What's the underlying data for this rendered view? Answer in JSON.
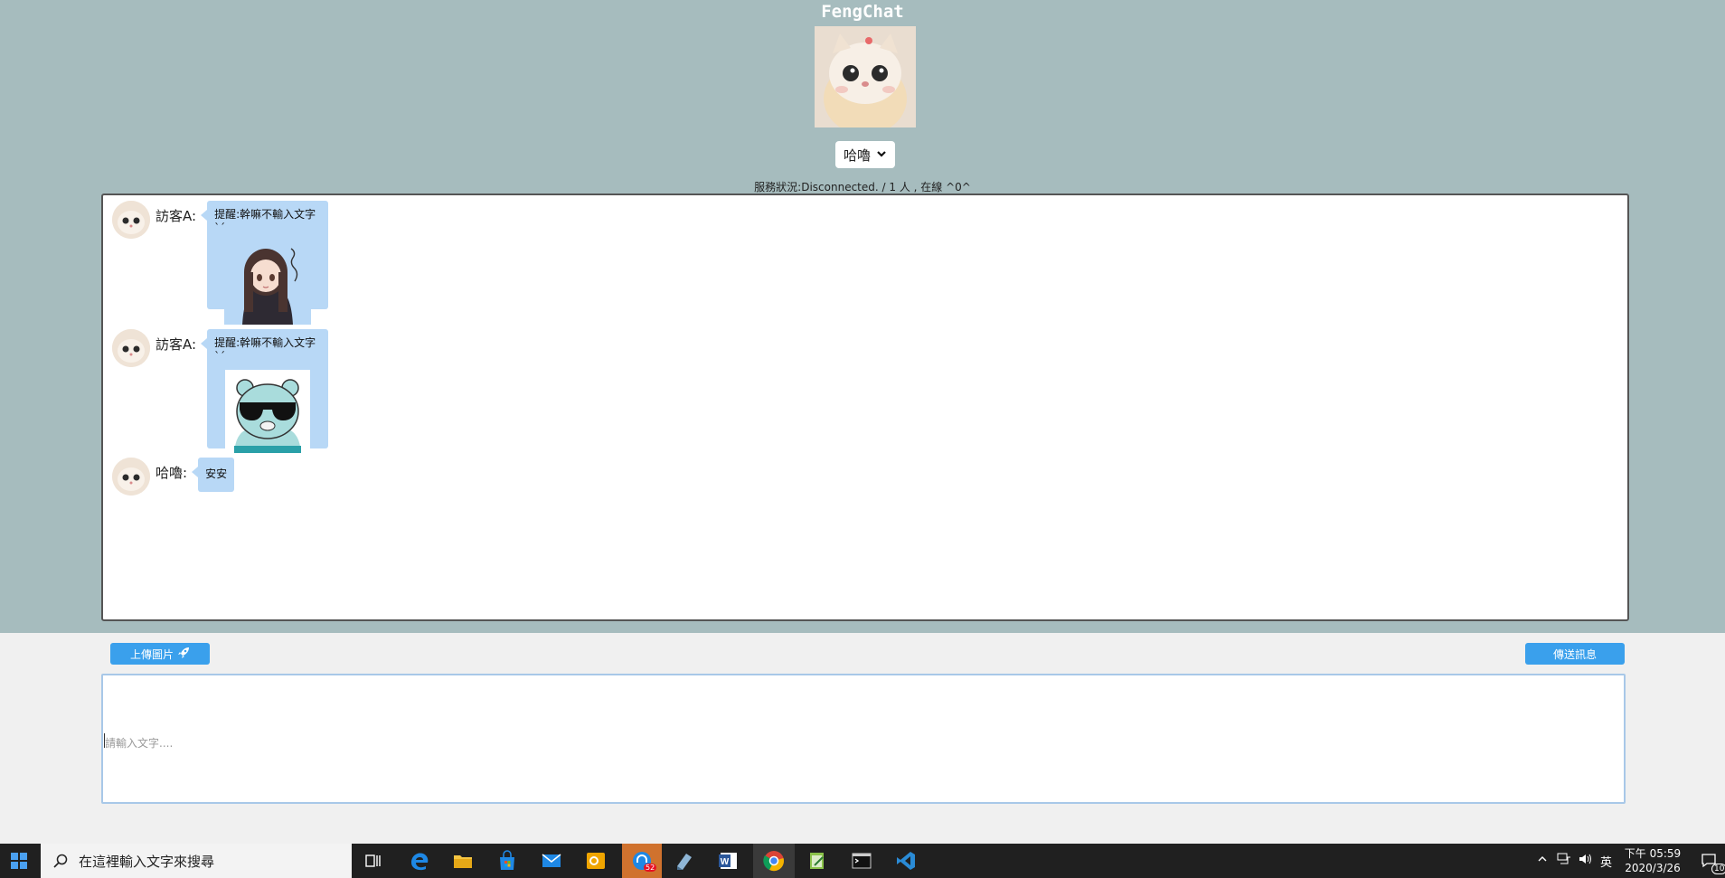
{
  "app": {
    "title": "FengChat"
  },
  "user_select": {
    "selected": "哈嚕"
  },
  "status": {
    "text": "服務狀況:Disconnected. / 1 人 , 在線 ^0^"
  },
  "messages": [
    {
      "sender": "訪客A:",
      "text": "提醒:幹嘛不輸入文字ˋˊ",
      "kind": "sticker-girl"
    },
    {
      "sender": "訪客A:",
      "text": "提醒:幹嘛不輸入文字ˋˊ",
      "kind": "sticker-bear"
    },
    {
      "sender": "哈嚕:",
      "text": "安安",
      "kind": "text"
    }
  ],
  "toolbar": {
    "upload_label": "上傳圖片",
    "send_label": "傳送訊息"
  },
  "input": {
    "placeholder": "請輸入文字...."
  },
  "taskbar": {
    "search_placeholder": "在這裡輸入文字來搜尋",
    "badge_count": "52",
    "ime": "英",
    "time": "下午 05:59",
    "date": "2020/3/26",
    "notification_count": "10"
  },
  "colors": {
    "top_bg": "#a6bcbe",
    "bubble": "#b8d8f6",
    "button": "#3aa0ec"
  }
}
